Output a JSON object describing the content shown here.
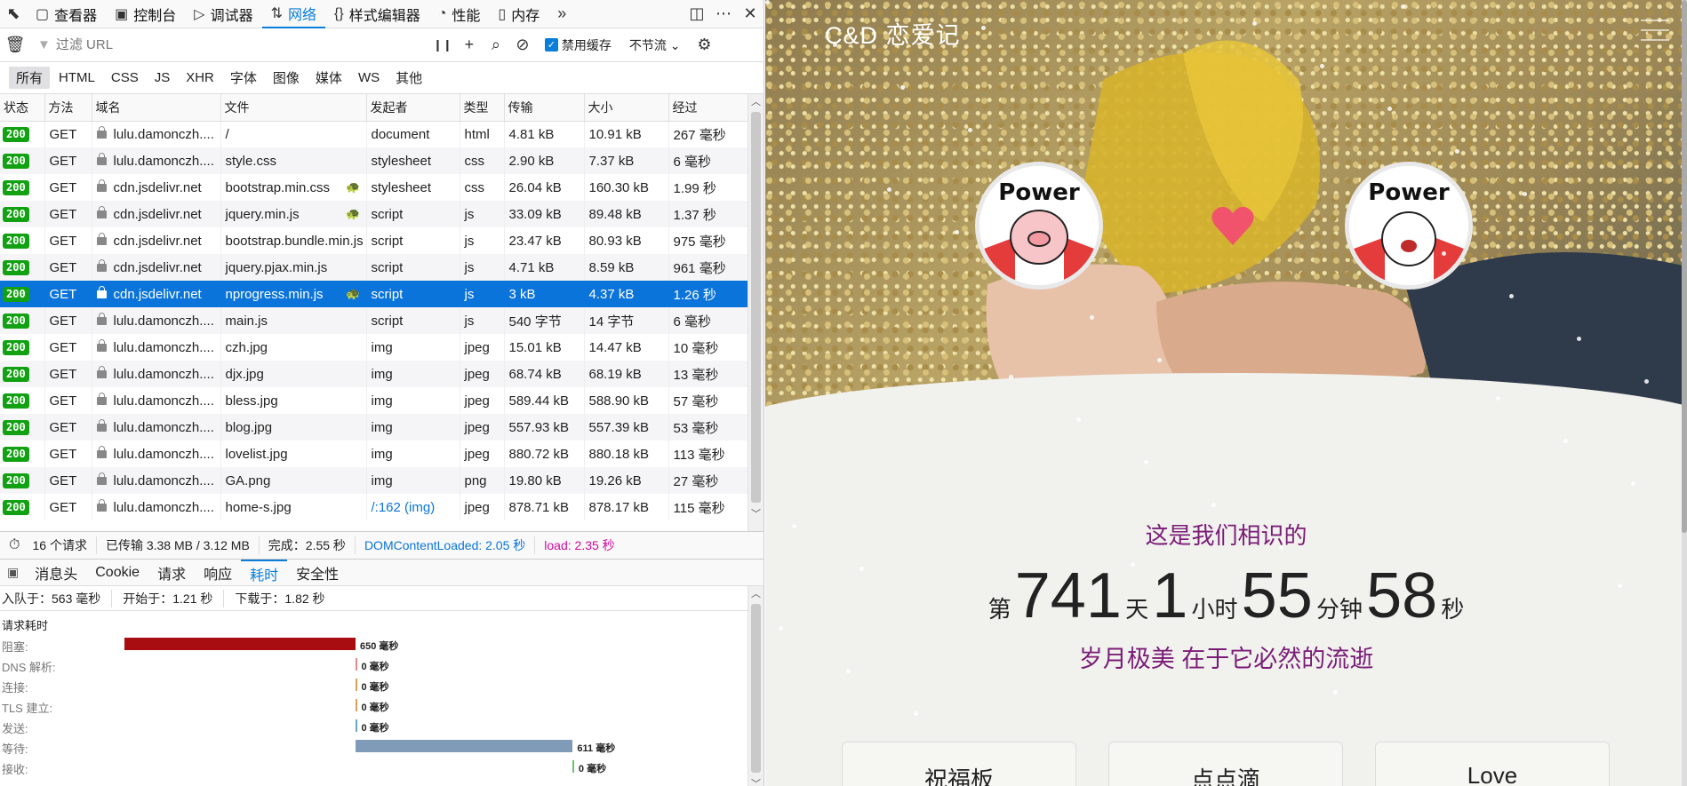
{
  "devtools": {
    "toolbar": {
      "tabs": [
        {
          "icon": "inspector-icon",
          "glyph": "▢",
          "label": "查看器"
        },
        {
          "icon": "console-icon",
          "glyph": "▣",
          "label": "控制台"
        },
        {
          "icon": "debugger-icon",
          "glyph": "▷",
          "label": "调试器"
        },
        {
          "icon": "network-icon",
          "glyph": "⇅",
          "label": "网络",
          "active": true
        },
        {
          "icon": "style-editor-icon",
          "glyph": "{}",
          "label": "样式编辑器"
        },
        {
          "icon": "performance-icon",
          "glyph": "◔",
          "label": "性能"
        },
        {
          "icon": "memory-icon",
          "glyph": "▯",
          "label": "内存"
        }
      ]
    },
    "filter": {
      "placeholder": "过滤 URL",
      "disable_cache": "禁用缓存",
      "throttle": "不节流 ⌄"
    },
    "type_filters": [
      "所有",
      "HTML",
      "CSS",
      "JS",
      "XHR",
      "字体",
      "图像",
      "媒体",
      "WS",
      "其他"
    ],
    "columns": [
      "状态",
      "方法",
      "域名",
      "文件",
      "发起者",
      "类型",
      "传输",
      "大小",
      "经过"
    ],
    "requests": [
      {
        "status": "200",
        "method": "GET",
        "domain": "lulu.damonczh....",
        "file": "/",
        "initiator": "document",
        "type": "html",
        "transferred": "4.81 kB",
        "size": "10.91 kB",
        "time": "267 毫秒"
      },
      {
        "status": "200",
        "method": "GET",
        "domain": "lulu.damonczh....",
        "file": "style.css",
        "initiator": "stylesheet",
        "type": "css",
        "transferred": "2.90 kB",
        "size": "7.37 kB",
        "time": "6 毫秒"
      },
      {
        "status": "200",
        "method": "GET",
        "domain": "cdn.jsdelivr.net",
        "file": "bootstrap.min.css",
        "initiator": "stylesheet",
        "type": "css",
        "transferred": "26.04 kB",
        "size": "160.30 kB",
        "time": "1.99 秒",
        "turtle": true
      },
      {
        "status": "200",
        "method": "GET",
        "domain": "cdn.jsdelivr.net",
        "file": "jquery.min.js",
        "initiator": "script",
        "type": "js",
        "transferred": "33.09 kB",
        "size": "89.48 kB",
        "time": "1.37 秒",
        "turtle": true
      },
      {
        "status": "200",
        "method": "GET",
        "domain": "cdn.jsdelivr.net",
        "file": "bootstrap.bundle.min.js",
        "initiator": "script",
        "type": "js",
        "transferred": "23.47 kB",
        "size": "80.93 kB",
        "time": "975 毫秒"
      },
      {
        "status": "200",
        "method": "GET",
        "domain": "cdn.jsdelivr.net",
        "file": "jquery.pjax.min.js",
        "initiator": "script",
        "type": "js",
        "transferred": "4.71 kB",
        "size": "8.59 kB",
        "time": "961 毫秒"
      },
      {
        "status": "200",
        "method": "GET",
        "domain": "cdn.jsdelivr.net",
        "file": "nprogress.min.js",
        "initiator": "script",
        "type": "js",
        "transferred": "3 kB",
        "size": "4.37 kB",
        "time": "1.26 秒",
        "turtle": true,
        "selected": true
      },
      {
        "status": "200",
        "method": "GET",
        "domain": "lulu.damonczh....",
        "file": "main.js",
        "initiator": "script",
        "type": "js",
        "transferred": "540 字节",
        "size": "14 字节",
        "time": "6 毫秒"
      },
      {
        "status": "200",
        "method": "GET",
        "domain": "lulu.damonczh....",
        "file": "czh.jpg",
        "initiator": "img",
        "type": "jpeg",
        "transferred": "15.01 kB",
        "size": "14.47 kB",
        "time": "10 毫秒"
      },
      {
        "status": "200",
        "method": "GET",
        "domain": "lulu.damonczh....",
        "file": "djx.jpg",
        "initiator": "img",
        "type": "jpeg",
        "transferred": "68.74 kB",
        "size": "68.19 kB",
        "time": "13 毫秒"
      },
      {
        "status": "200",
        "method": "GET",
        "domain": "lulu.damonczh....",
        "file": "bless.jpg",
        "initiator": "img",
        "type": "jpeg",
        "transferred": "589.44 kB",
        "size": "588.90 kB",
        "time": "57 毫秒"
      },
      {
        "status": "200",
        "method": "GET",
        "domain": "lulu.damonczh....",
        "file": "blog.jpg",
        "initiator": "img",
        "type": "jpeg",
        "transferred": "557.93 kB",
        "size": "557.39 kB",
        "time": "53 毫秒"
      },
      {
        "status": "200",
        "method": "GET",
        "domain": "lulu.damonczh....",
        "file": "lovelist.jpg",
        "initiator": "img",
        "type": "jpeg",
        "transferred": "880.72 kB",
        "size": "880.18 kB",
        "time": "113 毫秒"
      },
      {
        "status": "200",
        "method": "GET",
        "domain": "lulu.damonczh....",
        "file": "GA.png",
        "initiator": "img",
        "type": "png",
        "transferred": "19.80 kB",
        "size": "19.26 kB",
        "time": "27 毫秒"
      },
      {
        "status": "200",
        "method": "GET",
        "domain": "lulu.damonczh....",
        "file": "home-s.jpg",
        "initiator": "/:162 (img)",
        "type": "jpeg",
        "transferred": "878.71 kB",
        "size": "878.17 kB",
        "time": "115 毫秒"
      }
    ],
    "summary": {
      "requests": "16 个请求",
      "transferred": "已传输 3.38 MB / 3.12 MB",
      "finish": "完成：2.55 秒",
      "dcl": "DOMContentLoaded: 2.05 秒",
      "load": "load: 2.35 秒"
    },
    "detail_tabs": [
      "消息头",
      "Cookie",
      "请求",
      "响应",
      "耗时",
      "安全性"
    ],
    "timing": {
      "queued": "入队于：563 毫秒",
      "started": "开始于：1.21 秒",
      "downloaded": "下载于：1.82 秒",
      "section": "请求耗时",
      "phases": [
        {
          "label": "阻塞:",
          "value": "650 毫秒",
          "color": "#a80d12"
        },
        {
          "label": "DNS 解析:",
          "value": "0 毫秒",
          "color": "#e38a8a"
        },
        {
          "label": "连接:",
          "value": "0 毫秒",
          "color": "#d8a058"
        },
        {
          "label": "TLS 建立:",
          "value": "0 毫秒",
          "color": "#d8a058"
        },
        {
          "label": "发送:",
          "value": "0 毫秒",
          "color": "#6aa7c7"
        },
        {
          "label": "等待:",
          "value": "611 毫秒",
          "color": "#7f9bb8"
        },
        {
          "label": "接收:",
          "value": "0 毫秒",
          "color": "#6fc06f"
        }
      ]
    }
  },
  "page": {
    "logo": "C&D 恋爱记",
    "intro": "这是我们相识的",
    "counter": {
      "p1": "第",
      "days": "741",
      "p2": "天",
      "hours": "1",
      "p3": "小时",
      "minutes": "55",
      "p4": "分钟",
      "seconds": "58",
      "p5": "秒"
    },
    "tagline": "岁月极美 在于它必然的流逝",
    "cards": [
      "祝福板",
      "点点滴",
      "Love"
    ],
    "avatar_text": "Power"
  }
}
